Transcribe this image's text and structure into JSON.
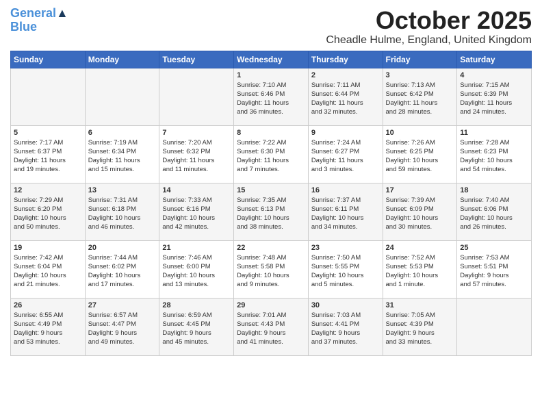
{
  "logo": {
    "line1": "General",
    "line2": "Blue"
  },
  "title": "October 2025",
  "subtitle": "Cheadle Hulme, England, United Kingdom",
  "headers": [
    "Sunday",
    "Monday",
    "Tuesday",
    "Wednesday",
    "Thursday",
    "Friday",
    "Saturday"
  ],
  "weeks": [
    [
      {
        "day": "",
        "info": ""
      },
      {
        "day": "",
        "info": ""
      },
      {
        "day": "",
        "info": ""
      },
      {
        "day": "1",
        "info": "Sunrise: 7:10 AM\nSunset: 6:46 PM\nDaylight: 11 hours\nand 36 minutes."
      },
      {
        "day": "2",
        "info": "Sunrise: 7:11 AM\nSunset: 6:44 PM\nDaylight: 11 hours\nand 32 minutes."
      },
      {
        "day": "3",
        "info": "Sunrise: 7:13 AM\nSunset: 6:42 PM\nDaylight: 11 hours\nand 28 minutes."
      },
      {
        "day": "4",
        "info": "Sunrise: 7:15 AM\nSunset: 6:39 PM\nDaylight: 11 hours\nand 24 minutes."
      }
    ],
    [
      {
        "day": "5",
        "info": "Sunrise: 7:17 AM\nSunset: 6:37 PM\nDaylight: 11 hours\nand 19 minutes."
      },
      {
        "day": "6",
        "info": "Sunrise: 7:19 AM\nSunset: 6:34 PM\nDaylight: 11 hours\nand 15 minutes."
      },
      {
        "day": "7",
        "info": "Sunrise: 7:20 AM\nSunset: 6:32 PM\nDaylight: 11 hours\nand 11 minutes."
      },
      {
        "day": "8",
        "info": "Sunrise: 7:22 AM\nSunset: 6:30 PM\nDaylight: 11 hours\nand 7 minutes."
      },
      {
        "day": "9",
        "info": "Sunrise: 7:24 AM\nSunset: 6:27 PM\nDaylight: 11 hours\nand 3 minutes."
      },
      {
        "day": "10",
        "info": "Sunrise: 7:26 AM\nSunset: 6:25 PM\nDaylight: 10 hours\nand 59 minutes."
      },
      {
        "day": "11",
        "info": "Sunrise: 7:28 AM\nSunset: 6:23 PM\nDaylight: 10 hours\nand 54 minutes."
      }
    ],
    [
      {
        "day": "12",
        "info": "Sunrise: 7:29 AM\nSunset: 6:20 PM\nDaylight: 10 hours\nand 50 minutes."
      },
      {
        "day": "13",
        "info": "Sunrise: 7:31 AM\nSunset: 6:18 PM\nDaylight: 10 hours\nand 46 minutes."
      },
      {
        "day": "14",
        "info": "Sunrise: 7:33 AM\nSunset: 6:16 PM\nDaylight: 10 hours\nand 42 minutes."
      },
      {
        "day": "15",
        "info": "Sunrise: 7:35 AM\nSunset: 6:13 PM\nDaylight: 10 hours\nand 38 minutes."
      },
      {
        "day": "16",
        "info": "Sunrise: 7:37 AM\nSunset: 6:11 PM\nDaylight: 10 hours\nand 34 minutes."
      },
      {
        "day": "17",
        "info": "Sunrise: 7:39 AM\nSunset: 6:09 PM\nDaylight: 10 hours\nand 30 minutes."
      },
      {
        "day": "18",
        "info": "Sunrise: 7:40 AM\nSunset: 6:06 PM\nDaylight: 10 hours\nand 26 minutes."
      }
    ],
    [
      {
        "day": "19",
        "info": "Sunrise: 7:42 AM\nSunset: 6:04 PM\nDaylight: 10 hours\nand 21 minutes."
      },
      {
        "day": "20",
        "info": "Sunrise: 7:44 AM\nSunset: 6:02 PM\nDaylight: 10 hours\nand 17 minutes."
      },
      {
        "day": "21",
        "info": "Sunrise: 7:46 AM\nSunset: 6:00 PM\nDaylight: 10 hours\nand 13 minutes."
      },
      {
        "day": "22",
        "info": "Sunrise: 7:48 AM\nSunset: 5:58 PM\nDaylight: 10 hours\nand 9 minutes."
      },
      {
        "day": "23",
        "info": "Sunrise: 7:50 AM\nSunset: 5:55 PM\nDaylight: 10 hours\nand 5 minutes."
      },
      {
        "day": "24",
        "info": "Sunrise: 7:52 AM\nSunset: 5:53 PM\nDaylight: 10 hours\nand 1 minute."
      },
      {
        "day": "25",
        "info": "Sunrise: 7:53 AM\nSunset: 5:51 PM\nDaylight: 9 hours\nand 57 minutes."
      }
    ],
    [
      {
        "day": "26",
        "info": "Sunrise: 6:55 AM\nSunset: 4:49 PM\nDaylight: 9 hours\nand 53 minutes."
      },
      {
        "day": "27",
        "info": "Sunrise: 6:57 AM\nSunset: 4:47 PM\nDaylight: 9 hours\nand 49 minutes."
      },
      {
        "day": "28",
        "info": "Sunrise: 6:59 AM\nSunset: 4:45 PM\nDaylight: 9 hours\nand 45 minutes."
      },
      {
        "day": "29",
        "info": "Sunrise: 7:01 AM\nSunset: 4:43 PM\nDaylight: 9 hours\nand 41 minutes."
      },
      {
        "day": "30",
        "info": "Sunrise: 7:03 AM\nSunset: 4:41 PM\nDaylight: 9 hours\nand 37 minutes."
      },
      {
        "day": "31",
        "info": "Sunrise: 7:05 AM\nSunset: 4:39 PM\nDaylight: 9 hours\nand 33 minutes."
      },
      {
        "day": "",
        "info": ""
      }
    ]
  ]
}
